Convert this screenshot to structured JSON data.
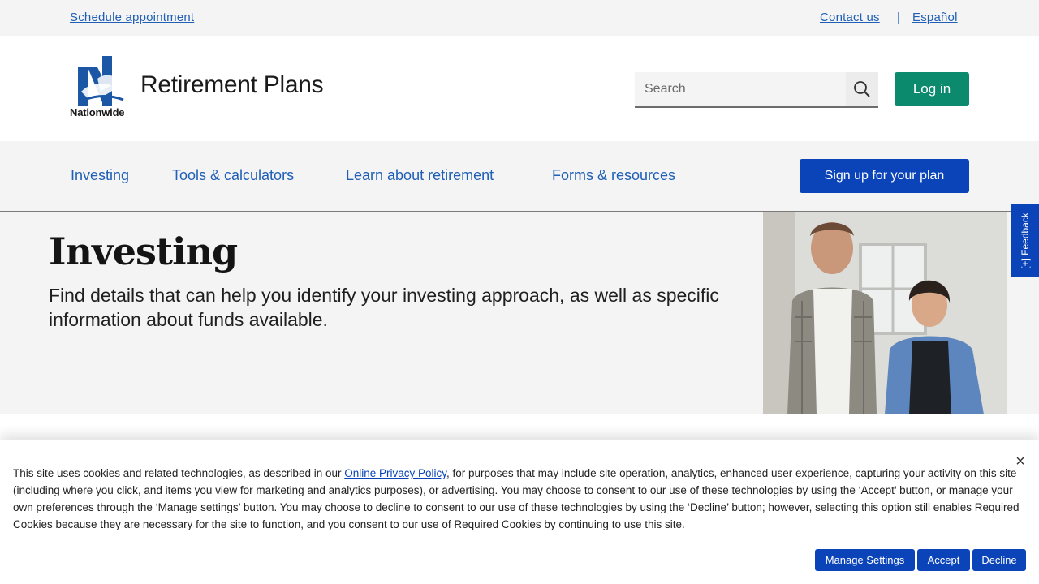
{
  "utility": {
    "schedule": "Schedule appointment",
    "contact": "Contact us",
    "separator": "|",
    "spanish": "Español"
  },
  "header": {
    "logo_word": "Nationwide",
    "site_title": "Retirement Plans",
    "search_placeholder": "Search",
    "search_icon": "search-icon",
    "login": "Log in"
  },
  "nav": {
    "items": [
      "Investing",
      "Tools & calculators",
      "Learn about retirement",
      "Forms & resources"
    ],
    "signup": "Sign up for your plan"
  },
  "hero": {
    "title": "Investing",
    "description": "Find details that can help you identify your investing approach, as well as specific information about funds available."
  },
  "feedback": {
    "label": "[+] Feedback"
  },
  "cookie": {
    "text_before_link": "This site uses cookies and related technologies, as described in our ",
    "link": "Online Privacy Policy",
    "text_after_link": ", for purposes that may include site operation, analytics, enhanced user experience, capturing your activity on this site (including where you click, and items you view for marketing and analytics purposes), or advertising. You may choose to consent to our use of these technologies by using the ‘Accept’ button, or manage your own preferences through the ‘Manage settings’ button. You may choose to decline to consent to our use of these technologies by using the ‘Decline’ button; however, selecting this option still enables Required Cookies because they are necessary for the site to function, and you consent to our use of Required Cookies by continuing to use this site.",
    "close": "×",
    "manage": "Manage Settings",
    "accept": "Accept",
    "decline": "Decline"
  },
  "colors": {
    "link_blue": "#1f5fb5",
    "primary_blue": "#0b44b8",
    "login_green": "#0b8a6e",
    "band_gray": "#f4f4f4"
  }
}
